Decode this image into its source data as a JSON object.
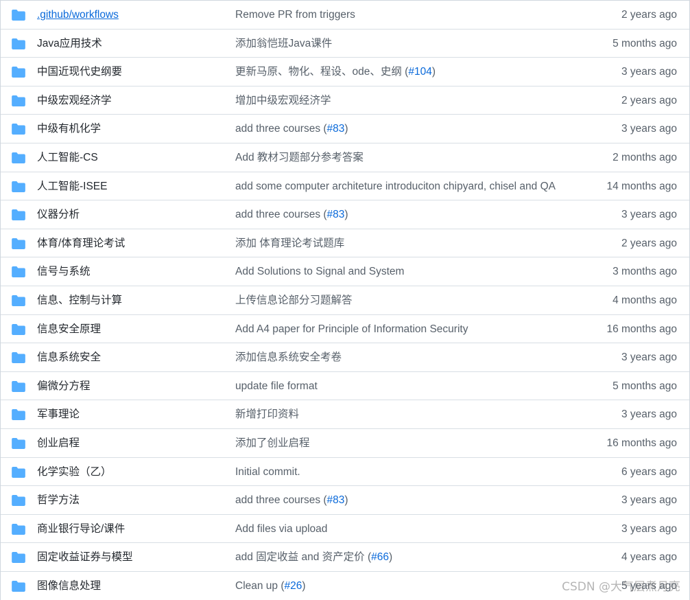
{
  "rows": [
    {
      "name": ".github/workflows",
      "msg_pre": "Remove PR from triggers",
      "pr": "",
      "msg_post": "",
      "age": "2 years ago",
      "underline": true
    },
    {
      "name": "Java应用技术",
      "msg_pre": "添加翁恺班Java课件",
      "pr": "",
      "msg_post": "",
      "age": "5 months ago"
    },
    {
      "name": "中国近现代史纲要",
      "msg_pre": "更新马原、物化、程设、ode、史纲 (",
      "pr": "#104",
      "msg_post": ")",
      "age": "3 years ago"
    },
    {
      "name": "中级宏观经济学",
      "msg_pre": "增加中级宏观经济学",
      "pr": "",
      "msg_post": "",
      "age": "2 years ago"
    },
    {
      "name": "中级有机化学",
      "msg_pre": "add three courses (",
      "pr": "#83",
      "msg_post": ")",
      "age": "3 years ago"
    },
    {
      "name": "人工智能-CS",
      "msg_pre": "Add 教材习题部分参考答案",
      "pr": "",
      "msg_post": "",
      "age": "2 months ago"
    },
    {
      "name": "人工智能-ISEE",
      "msg_pre": "add some computer architeture introduciton chipyard, chisel and QA",
      "pr": "",
      "msg_post": "",
      "age": "14 months ago"
    },
    {
      "name": "仪器分析",
      "msg_pre": "add three courses (",
      "pr": "#83",
      "msg_post": ")",
      "age": "3 years ago"
    },
    {
      "name": "体育/体育理论考试",
      "msg_pre": "添加 体育理论考试题库",
      "pr": "",
      "msg_post": "",
      "age": "2 years ago"
    },
    {
      "name": "信号与系统",
      "msg_pre": "Add Solutions to Signal and System",
      "pr": "",
      "msg_post": "",
      "age": "3 months ago"
    },
    {
      "name": "信息、控制与计算",
      "msg_pre": "上传信息论部分习题解答",
      "pr": "",
      "msg_post": "",
      "age": "4 months ago"
    },
    {
      "name": "信息安全原理",
      "msg_pre": "Add A4 paper for Principle of Information Security",
      "pr": "",
      "msg_post": "",
      "age": "16 months ago"
    },
    {
      "name": "信息系统安全",
      "msg_pre": "添加信息系统安全考卷",
      "pr": "",
      "msg_post": "",
      "age": "3 years ago"
    },
    {
      "name": "偏微分方程",
      "msg_pre": "update file format",
      "pr": "",
      "msg_post": "",
      "age": "5 months ago"
    },
    {
      "name": "军事理论",
      "msg_pre": "新增打印资料",
      "pr": "",
      "msg_post": "",
      "age": "3 years ago"
    },
    {
      "name": "创业启程",
      "msg_pre": "添加了创业启程",
      "pr": "",
      "msg_post": "",
      "age": "16 months ago"
    },
    {
      "name": "化学实验（乙）",
      "msg_pre": "Initial commit.",
      "pr": "",
      "msg_post": "",
      "age": "6 years ago"
    },
    {
      "name": "哲学方法",
      "msg_pre": "add three courses (",
      "pr": "#83",
      "msg_post": ")",
      "age": "3 years ago"
    },
    {
      "name": "商业银行导论/课件",
      "msg_pre": "Add files via upload",
      "pr": "",
      "msg_post": "",
      "age": "3 years ago"
    },
    {
      "name": "固定收益证券与模型",
      "msg_pre": "add 固定收益 and 资产定价 (",
      "pr": "#66",
      "msg_post": ")",
      "age": "4 years ago"
    },
    {
      "name": "图像信息处理",
      "msg_pre": "Clean up (",
      "pr": "#26",
      "msg_post": ")",
      "age": "5 years ago"
    }
  ],
  "icon": "folder-icon",
  "colors": {
    "folder": "#54aeff",
    "link": "#0969da",
    "muted": "#57606a",
    "border": "#d8dee4"
  },
  "watermark": "CSDN @大气层煮月亮"
}
